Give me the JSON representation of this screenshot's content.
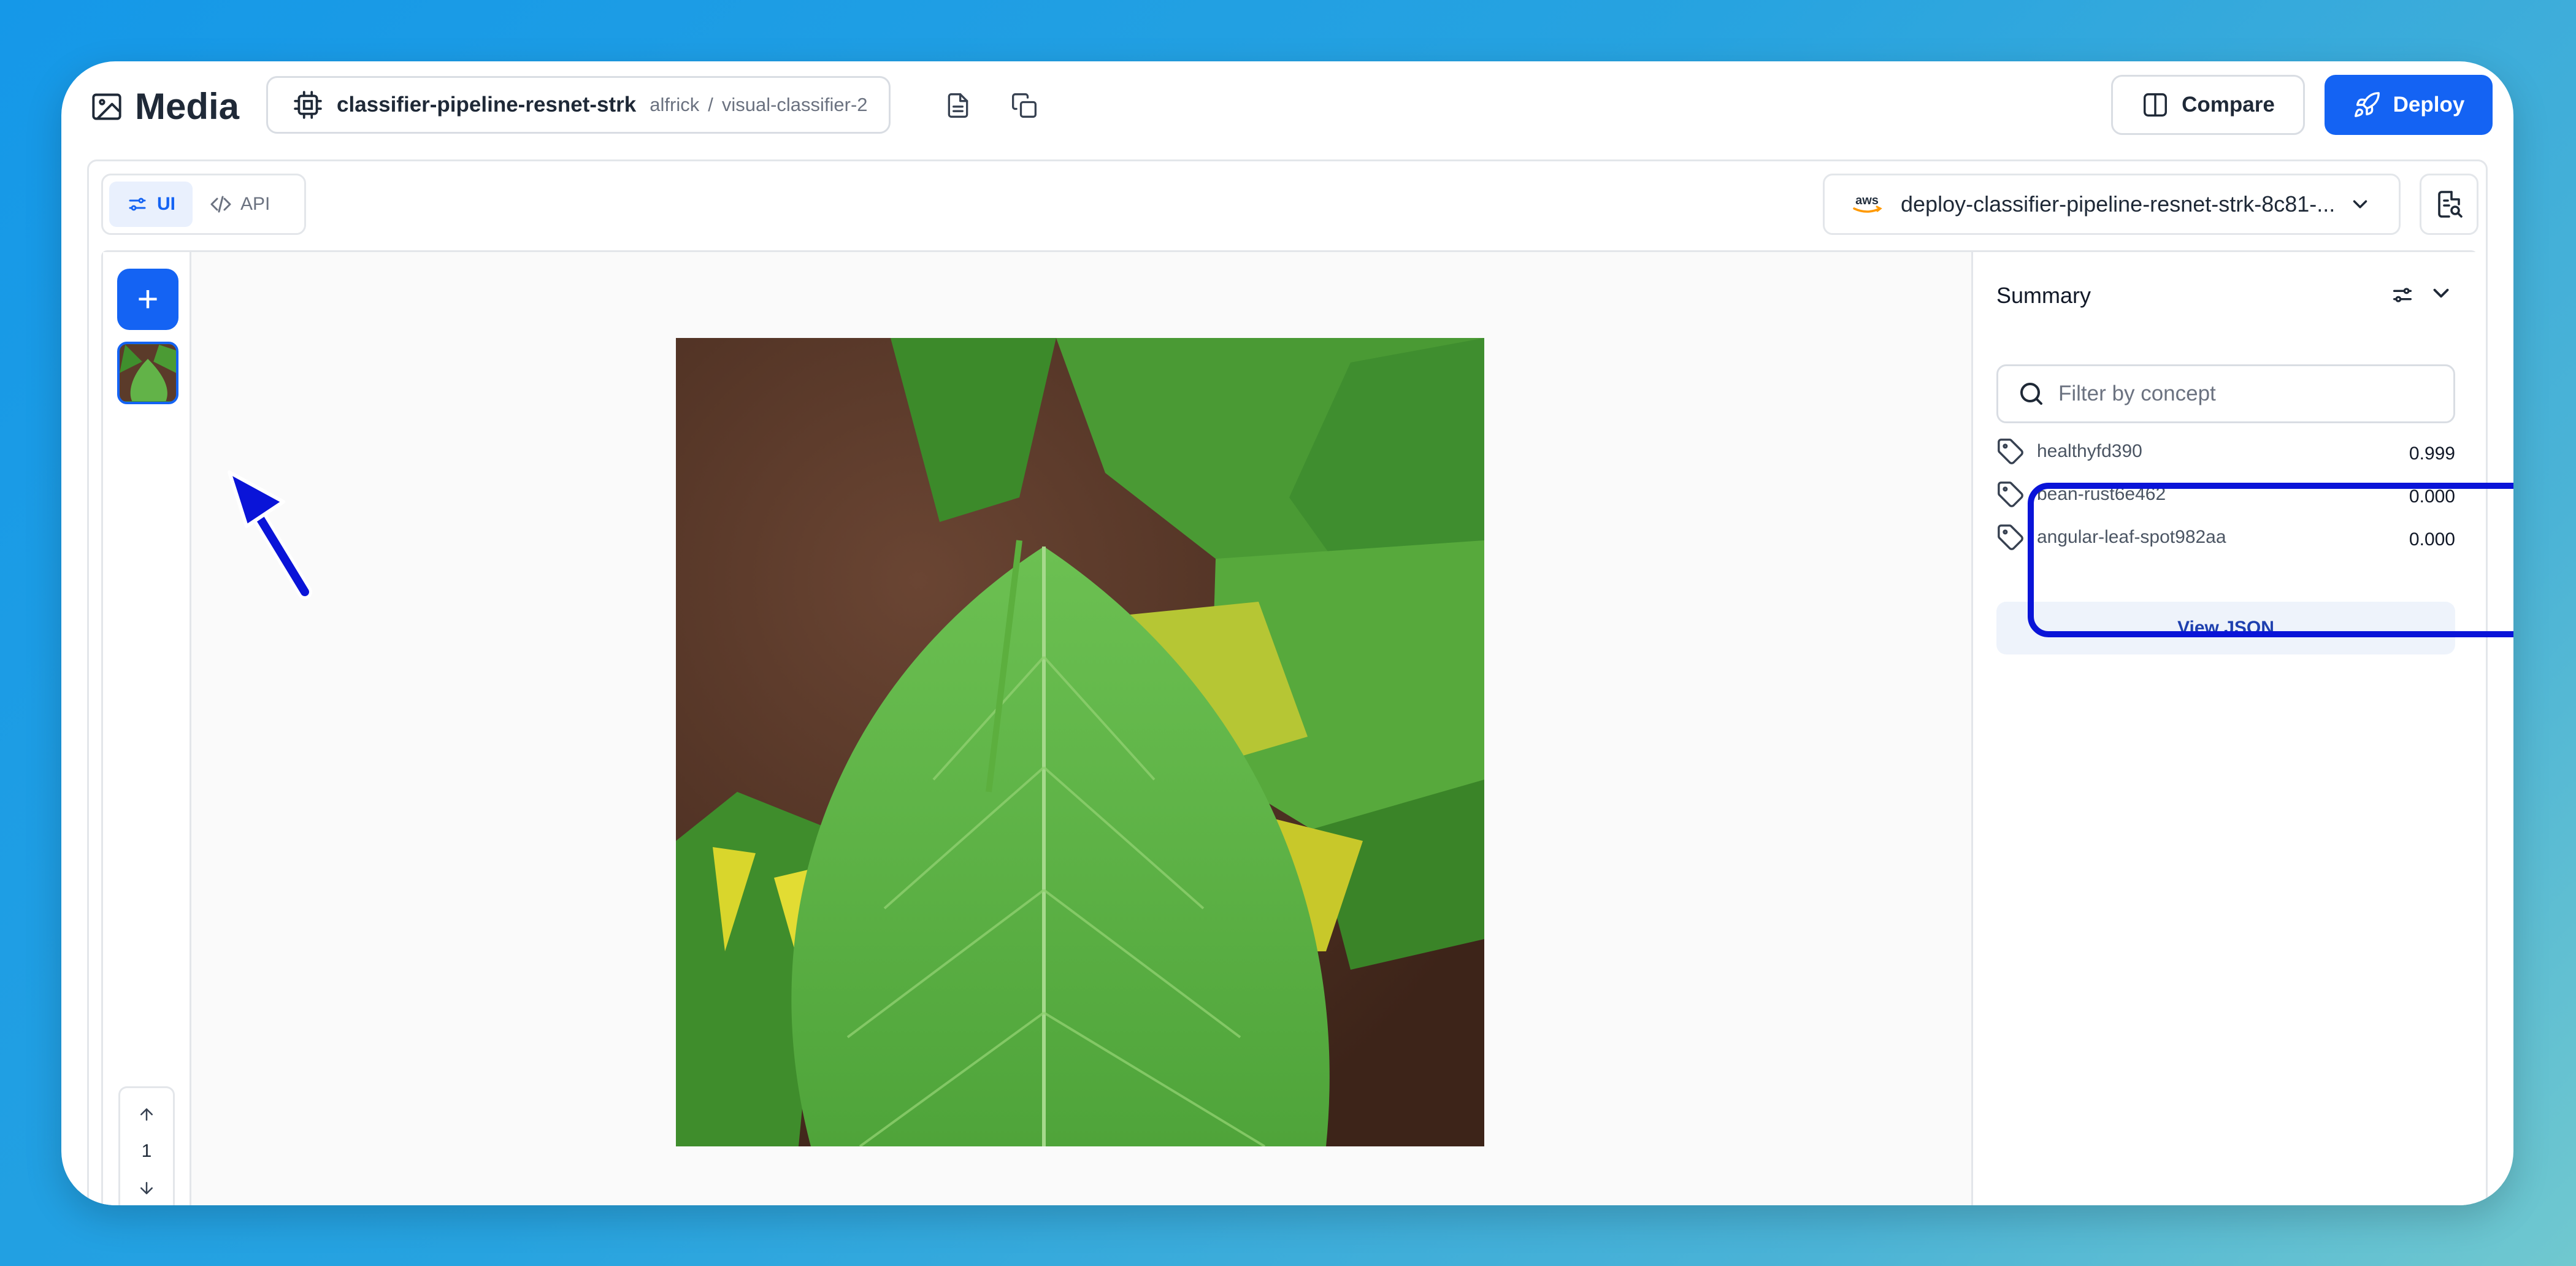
{
  "header": {
    "title": "Media",
    "pipeline_name": "classifier-pipeline-resnet-strk",
    "path_owner": "alfrick",
    "path_separator": "/",
    "path_app": "visual-classifier-2",
    "compare_label": "Compare",
    "deploy_label": "Deploy"
  },
  "toolbar": {
    "mode_ui": "UI",
    "mode_api": "API",
    "deployment_label": "deploy-classifier-pipeline-resnet-strk-8c81-...",
    "cloud_badge": "aws"
  },
  "pager": {
    "page": "1"
  },
  "summary": {
    "title": "Summary",
    "filter_placeholder": "Filter by concept",
    "concepts": [
      {
        "name": "healthyfd390",
        "score": "0.999"
      },
      {
        "name": "bean-rust6e462",
        "score": "0.000"
      },
      {
        "name": "angular-leaf-spot982aa",
        "score": "0.000"
      }
    ],
    "view_json_label": "View JSON"
  },
  "colors": {
    "accent": "#1463f3",
    "highlight": "#0a14d8",
    "background_gradient_start": "#1598e8",
    "background_gradient_end": "#70c8cf"
  }
}
